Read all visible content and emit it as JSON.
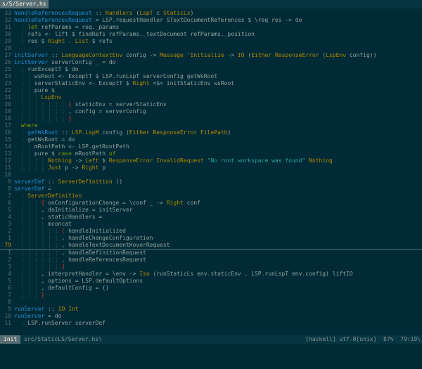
{
  "tabbar": {
    "tab_label": "s/S/Server.hs"
  },
  "colors": {
    "background": "#002b36",
    "function": "#268bd2",
    "type": "#b58900",
    "string": "#2aa198",
    "keyword": "#859900"
  },
  "code": [
    {
      "n": "33",
      "t": [
        [
          "fn",
          "handleReferencesRequest"
        ],
        [
          "txt",
          " :: "
        ],
        [
          "ty",
          "Handlers"
        ],
        [
          "txt",
          " ("
        ],
        [
          "ty",
          "LspT"
        ],
        [
          "txt",
          " c "
        ],
        [
          "ty",
          "StaticLs"
        ],
        [
          "txt",
          ")"
        ]
      ]
    },
    {
      "n": "32",
      "t": [
        [
          "fn",
          "handleReferencesRequest"
        ],
        [
          "txt",
          " = LSP.requestHandler STextDocumentReferences $ \\req res -> do"
        ]
      ]
    },
    {
      "n": "31",
      "t": [
        [
          "g",
          "  ¦ "
        ],
        [
          "kw",
          "let"
        ],
        [
          "txt",
          " refParams = req._params"
        ]
      ]
    },
    {
      "n": "30",
      "t": [
        [
          "g",
          "  ¦ "
        ],
        [
          "txt",
          "refs <- lift $ findRefs refParams._textDocument refParams._position"
        ]
      ]
    },
    {
      "n": "29",
      "t": [
        [
          "g",
          "  ¦ "
        ],
        [
          "txt",
          "res $ "
        ],
        [
          "ty",
          "Right"
        ],
        [
          "txt",
          " . "
        ],
        [
          "ty",
          "List"
        ],
        [
          "txt",
          " $ refs"
        ]
      ]
    },
    {
      "n": "28",
      "t": []
    },
    {
      "n": "27",
      "t": [
        [
          "fn",
          "initServer"
        ],
        [
          "txt",
          " :: "
        ],
        [
          "ty",
          "LanguageContextEnv"
        ],
        [
          "txt",
          " config -> "
        ],
        [
          "ty",
          "Message"
        ],
        [
          "txt",
          " '"
        ],
        [
          "ty",
          "Initialize"
        ],
        [
          "txt",
          " -> "
        ],
        [
          "ty",
          "IO"
        ],
        [
          "txt",
          " ("
        ],
        [
          "ty",
          "Either ResponseError"
        ],
        [
          "txt",
          " ("
        ],
        [
          "ty",
          "LspEnv"
        ],
        [
          "txt",
          " config))"
        ]
      ]
    },
    {
      "n": "26",
      "t": [
        [
          "fn",
          "initServer"
        ],
        [
          "txt",
          " serverConfig _ = do"
        ]
      ]
    },
    {
      "n": "25",
      "t": [
        [
          "g",
          "  ¦ "
        ],
        [
          "txt",
          "runExceptT $ do"
        ]
      ]
    },
    {
      "n": "24",
      "t": [
        [
          "g",
          "  ¦ ¦ "
        ],
        [
          "txt",
          "wsRoot <- ExceptT $ LSP.runLspT serverConfig getWsRoot"
        ]
      ]
    },
    {
      "n": "23",
      "t": [
        [
          "g",
          "  ¦ ¦ "
        ],
        [
          "txt",
          "serverStaticEnv <- ExceptT $ "
        ],
        [
          "ty",
          "Right"
        ],
        [
          "txt",
          " <$> initStaticEnv wsRoot"
        ]
      ]
    },
    {
      "n": "22",
      "t": [
        [
          "g",
          "  ¦ ¦ "
        ],
        [
          "txt",
          "pure $"
        ]
      ]
    },
    {
      "n": "21",
      "t": [
        [
          "g",
          "  ¦ ¦ ¦ "
        ],
        [
          "ty",
          "LspEnv"
        ]
      ]
    },
    {
      "n": "20",
      "t": [
        [
          "g",
          "  ¦ ¦ ¦ ¦ ¦ ¦ ¦ "
        ],
        [
          "br",
          "{"
        ],
        [
          "txt",
          " staticEnv = serverStaticEnv"
        ]
      ]
    },
    {
      "n": "19",
      "t": [
        [
          "g",
          "  ¦ ¦ ¦ ¦ ¦ ¦ ¦ "
        ],
        [
          "txt",
          ", config = serverConfig"
        ]
      ]
    },
    {
      "n": "18",
      "t": [
        [
          "g",
          "  ¦ ¦ ¦ ¦ ¦ ¦ ¦ "
        ],
        [
          "br",
          "}"
        ]
      ]
    },
    {
      "n": "17",
      "t": [
        [
          "kw",
          "  where"
        ]
      ]
    },
    {
      "n": "16",
      "t": [
        [
          "g",
          "  ¦ "
        ],
        [
          "fn",
          "getWsRoot"
        ],
        [
          "txt",
          " :: "
        ],
        [
          "ty",
          "LSP.LspM"
        ],
        [
          "txt",
          " config ("
        ],
        [
          "ty",
          "Either ResponseError FilePath"
        ],
        [
          "txt",
          ")"
        ]
      ]
    },
    {
      "n": "15",
      "t": [
        [
          "g",
          "  ¦ "
        ],
        [
          "txt",
          "getWsRoot = do"
        ]
      ]
    },
    {
      "n": "14",
      "t": [
        [
          "g",
          "  ¦ ¦ "
        ],
        [
          "txt",
          "mRootPath <- LSP.getRootPath"
        ]
      ]
    },
    {
      "n": "13",
      "t": [
        [
          "g",
          "  ¦ ¦ "
        ],
        [
          "txt",
          "pure $ "
        ],
        [
          "kw",
          "case"
        ],
        [
          "txt",
          " mRootPath "
        ],
        [
          "kw",
          "of"
        ]
      ]
    },
    {
      "n": "12",
      "t": [
        [
          "g",
          "  ¦ ¦ ¦ ¦ "
        ],
        [
          "ty",
          "Nothing"
        ],
        [
          "txt",
          " -> "
        ],
        [
          "ty",
          "Left"
        ],
        [
          "txt",
          " $ "
        ],
        [
          "ty",
          "ResponseError InvalidRequest"
        ],
        [
          "txt",
          " "
        ],
        [
          "st",
          "\"No root workspace was found\""
        ],
        [
          "txt",
          " "
        ],
        [
          "ty",
          "Nothing"
        ]
      ]
    },
    {
      "n": "11",
      "t": [
        [
          "g",
          "  ¦ ¦ ¦ ¦ "
        ],
        [
          "ty",
          "Just"
        ],
        [
          "txt",
          " p -> "
        ],
        [
          "ty",
          "Right"
        ],
        [
          "txt",
          " p"
        ]
      ]
    },
    {
      "n": "10",
      "t": []
    },
    {
      "n": "9",
      "t": [
        [
          "fn",
          "serverDef"
        ],
        [
          "txt",
          " :: "
        ],
        [
          "ty",
          "ServerDefinition"
        ],
        [
          "txt",
          " ()"
        ]
      ]
    },
    {
      "n": "8",
      "t": [
        [
          "fn",
          "serverDef"
        ],
        [
          "txt",
          " ="
        ]
      ]
    },
    {
      "n": "7",
      "t": [
        [
          "g",
          "  ¦ "
        ],
        [
          "ty",
          "ServerDefinition"
        ]
      ]
    },
    {
      "n": "6",
      "t": [
        [
          "g",
          "  ¦ ¦ ¦ "
        ],
        [
          "br",
          "{"
        ],
        [
          "txt",
          " onConfigurationChange = \\conf _ -> "
        ],
        [
          "ty",
          "Right"
        ],
        [
          "txt",
          " conf"
        ]
      ]
    },
    {
      "n": "5",
      "t": [
        [
          "g",
          "  ¦ ¦ ¦ "
        ],
        [
          "txt",
          ", doInitialize = initServer"
        ]
      ]
    },
    {
      "n": "4",
      "t": [
        [
          "g",
          "  ¦ ¦ ¦ "
        ],
        [
          "txt",
          ", staticHandlers ="
        ]
      ]
    },
    {
      "n": "3",
      "t": [
        [
          "g",
          "  ¦ ¦ ¦ ¦ "
        ],
        [
          "txt",
          "mconcat"
        ]
      ]
    },
    {
      "n": "2",
      "t": [
        [
          "g",
          "  ¦ ¦ ¦ ¦ ¦ ¦ "
        ],
        [
          "br",
          "["
        ],
        [
          "txt",
          " handleInitialized"
        ]
      ]
    },
    {
      "n": "1",
      "t": [
        [
          "g",
          "  ¦ ¦ ¦ ¦ ¦ ¦ "
        ],
        [
          "txt",
          ", handleChangeConfiguration"
        ]
      ]
    },
    {
      "n": "79",
      "cur": true,
      "t": [
        [
          "g",
          "  ¦ ¦ ¦ ¦ ¦ ¦ "
        ],
        [
          "txt",
          ", handleTextDocumentHoverRequest"
        ]
      ]
    },
    {
      "n": "1",
      "t": [
        [
          "g",
          "  ¦ ¦ ¦ ¦ ¦ ¦ "
        ],
        [
          "txt",
          ", handleDefinitionRequest"
        ]
      ]
    },
    {
      "n": "2",
      "t": [
        [
          "g",
          "  ¦ ¦ ¦ ¦ ¦ ¦ "
        ],
        [
          "txt",
          ", handleReferencesRequest"
        ]
      ]
    },
    {
      "n": "3",
      "t": [
        [
          "g",
          "  ¦ ¦ ¦ ¦ ¦ ¦ "
        ],
        [
          "br",
          "]"
        ]
      ]
    },
    {
      "n": "4",
      "t": [
        [
          "g",
          "  ¦ ¦ ¦ "
        ],
        [
          "txt",
          ", interpretHandler = \\env -> "
        ],
        [
          "ty",
          "Iso"
        ],
        [
          "txt",
          " (runStaticLs env.staticEnv . LSP.runLspT env.config) liftIO"
        ]
      ]
    },
    {
      "n": "5",
      "t": [
        [
          "g",
          "  ¦ ¦ ¦ "
        ],
        [
          "txt",
          ", options = LSP.defaultOptions"
        ]
      ]
    },
    {
      "n": "6",
      "t": [
        [
          "g",
          "  ¦ ¦ ¦ "
        ],
        [
          "txt",
          ", defaultConfig = ()"
        ]
      ]
    },
    {
      "n": "7",
      "t": [
        [
          "g",
          "  ¦ ¦ ¦ "
        ],
        [
          "br",
          "}"
        ]
      ]
    },
    {
      "n": "8",
      "t": []
    },
    {
      "n": "9",
      "t": [
        [
          "fn",
          "runServer"
        ],
        [
          "txt",
          " :: "
        ],
        [
          "ty",
          "IO Int"
        ]
      ]
    },
    {
      "n": "10",
      "t": [
        [
          "fn",
          "runServer"
        ],
        [
          "txt",
          " = do"
        ]
      ]
    },
    {
      "n": "11",
      "t": [
        [
          "g",
          "  ¦ "
        ],
        [
          "txt",
          "LSP.runServer serverDef"
        ]
      ]
    }
  ],
  "statusbar": {
    "mode": "init",
    "filename": "src/StaticLS/Server.hs\\",
    "right": "[haskell] utf-8[unix]  87%  79:19\\"
  }
}
